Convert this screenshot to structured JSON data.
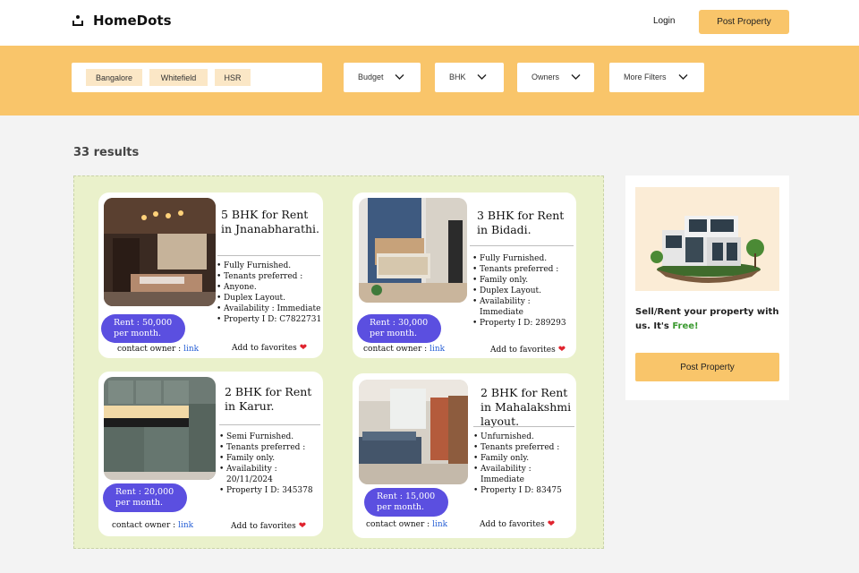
{
  "header": {
    "brand": "HomeDots",
    "login": "Login",
    "post_property": "Post Property"
  },
  "filters": {
    "locations": [
      "Bangalore",
      "Whitefield",
      "HSR"
    ],
    "dropdowns": [
      "Budget",
      "BHK",
      "Owners",
      "More Filters"
    ]
  },
  "results_count": "33 results",
  "listings": [
    {
      "title_line1": "5 BHK for Rent",
      "title_line2": "in Jnanabharathi.",
      "title_line3": "",
      "features": [
        "Fully Furnished.",
        "Tenants preferred :",
        "Anyone.",
        "Duplex Layout.",
        "Availability : Immediate",
        "Property I D: C7822731"
      ],
      "rent_line1": "Rent : 50,000",
      "rent_line2": "per month.",
      "contact_label": "contact owner : ",
      "contact_link": "link",
      "favorite": "Add to favorites"
    },
    {
      "title_line1": "3 BHK for Rent",
      "title_line2": "in Bidadi.",
      "title_line3": "",
      "features": [
        "Fully Furnished.",
        "Tenants preferred :",
        "Family only.",
        "Duplex Layout.",
        "Availability : Immediate",
        "Property I D: 289293"
      ],
      "rent_line1": "Rent : 30,000",
      "rent_line2": "per month.",
      "contact_label": "contact owner : ",
      "contact_link": "link",
      "favorite": "Add to favorites"
    },
    {
      "title_line1": "2 BHK for Rent",
      "title_line2": "in Karur.",
      "title_line3": "",
      "features": [
        "Semi Furnished.",
        "Tenants preferred :",
        "Family only.",
        "Availability : 20/11/2024",
        "Property I D: 345378"
      ],
      "rent_line1": "Rent : 20,000",
      "rent_line2": "per month.",
      "contact_label": "contact owner : ",
      "contact_link": "link",
      "favorite": "Add to favorites"
    },
    {
      "title_line1": "2 BHK for Rent",
      "title_line2": "in Mahalakshmi",
      "title_line3": "layout.",
      "features": [
        "Unfurnished.",
        "Tenants preferred :",
        "Family only.",
        "Availability : Immediate",
        "Property I D: 83475"
      ],
      "rent_line1": "Rent : 15,000",
      "rent_line2": "per month.",
      "contact_label": "contact owner : ",
      "contact_link": "link",
      "favorite": "Add to favorites"
    }
  ],
  "sidebar": {
    "promo_text": "Sell/Rent your property with us. It's",
    "promo_highlight": "Free!",
    "button": "Post Property"
  },
  "colors": {
    "accent": "#f9c56a",
    "panel_bg": "#eaf1cb",
    "rent_pill": "#5b4fe0",
    "link": "#2a62d6",
    "free_text": "#3b9a30"
  },
  "icons": {
    "logo": "house-dots-icon",
    "dropdown": "chevron-down-icon",
    "favorite": "heart-icon"
  }
}
